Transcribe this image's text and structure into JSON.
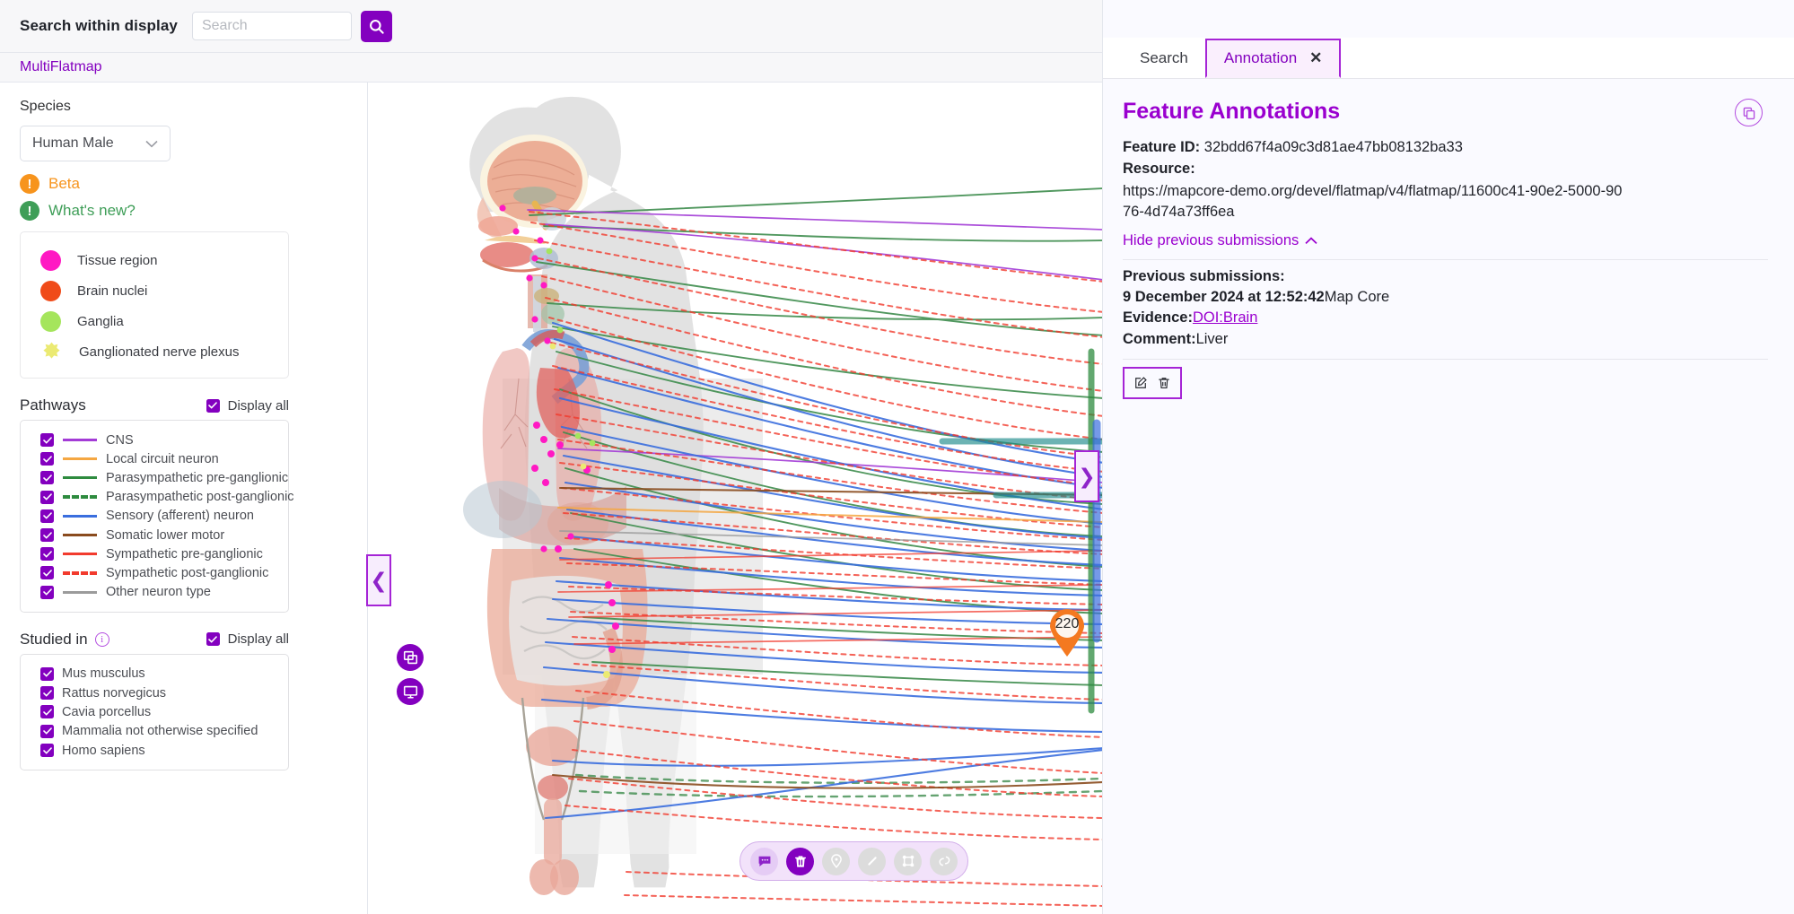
{
  "topbar": {
    "search_label": "Search within display",
    "search_value": "",
    "search_placeholder": "Search",
    "icons": [
      "window-icon",
      "help-icon",
      "fullscreen-icon",
      "link-icon"
    ]
  },
  "breadcrumb": {
    "label": "MultiFlatmap"
  },
  "sidebar": {
    "species_label": "Species",
    "species_value": "Human Male",
    "status": [
      {
        "label": "Beta",
        "color": "#f7941d",
        "glyph": "!"
      },
      {
        "label": "What's new?",
        "color": "#3f9e58",
        "glyph": "!"
      }
    ],
    "legend": [
      {
        "label": "Tissue region",
        "color": "#ff19c3",
        "shape": "circle"
      },
      {
        "label": "Brain nuclei",
        "color": "#f04b19",
        "shape": "circle"
      },
      {
        "label": "Ganglia",
        "color": "#a5e55c",
        "shape": "circle"
      },
      {
        "label": "Ganglionated nerve plexus",
        "color": "#ebea72",
        "shape": "star"
      }
    ],
    "pathways": {
      "title": "Pathways",
      "display_all_label": "Display all",
      "display_all_checked": true,
      "items": [
        {
          "label": "CNS",
          "color": "#a33bd6",
          "dashed": false,
          "checked": true
        },
        {
          "label": "Local circuit neuron",
          "color": "#f5a742",
          "dashed": false,
          "checked": true
        },
        {
          "label": "Parasympathetic pre-ganglionic",
          "color": "#2e8b3f",
          "dashed": false,
          "checked": true
        },
        {
          "label": "Parasympathetic post-ganglionic",
          "color": "#2e8b3f",
          "dashed": true,
          "checked": true
        },
        {
          "label": "Sensory (afferent) neuron",
          "color": "#3a6ede",
          "dashed": false,
          "checked": true
        },
        {
          "label": "Somatic lower motor",
          "color": "#8a4b1e",
          "dashed": false,
          "checked": true
        },
        {
          "label": "Sympathetic pre-ganglionic",
          "color": "#f23b2e",
          "dashed": false,
          "checked": true
        },
        {
          "label": "Sympathetic post-ganglionic",
          "color": "#f23b2e",
          "dashed": true,
          "checked": true
        },
        {
          "label": "Other neuron type",
          "color": "#9b9b9b",
          "dashed": false,
          "checked": true
        }
      ]
    },
    "studied_in": {
      "title": "Studied in",
      "info_glyph": "i",
      "display_all_label": "Display all",
      "display_all_checked": true,
      "items": [
        {
          "label": "Mus musculus",
          "checked": true
        },
        {
          "label": "Rattus norvegicus",
          "checked": true
        },
        {
          "label": "Cavia porcellus",
          "checked": true
        },
        {
          "label": "Mammalia not otherwise specified",
          "checked": true
        },
        {
          "label": "Homo sapiens",
          "checked": true
        }
      ]
    }
  },
  "map": {
    "marker_label": "220",
    "marker_color": "#f47920",
    "collapse_left_glyph": "❮",
    "collapse_right_glyph": "❯",
    "side_buttons": [
      "layers-icon",
      "display-icon"
    ],
    "toolbar": [
      {
        "name": "comment-tool",
        "state": "light"
      },
      {
        "name": "delete-tool",
        "state": "active"
      },
      {
        "name": "marker-tool",
        "state": "grey"
      },
      {
        "name": "line-tool",
        "state": "grey"
      },
      {
        "name": "polygon-tool",
        "state": "grey"
      },
      {
        "name": "connection-tool",
        "state": "grey"
      }
    ]
  },
  "panel": {
    "tabs": [
      {
        "label": "Search",
        "active": false,
        "closable": false
      },
      {
        "label": "Annotation",
        "active": true,
        "closable": true,
        "close_glyph": "✕"
      }
    ],
    "title": "Feature Annotations",
    "feature_id_label": "Feature ID:",
    "feature_id_value": "32bdd67f4a09c3d81ae47bb08132ba33",
    "resource_label": "Resource:",
    "resource_value": "https://mapcore-demo.org/devel/flatmap/v4/flatmap/11600c41-90e2-5000-9076-4d74a73ff6ea",
    "hide_link_label": "Hide previous submissions",
    "hide_link_glyph": "⌃",
    "previous_label": "Previous submissions:",
    "submission": {
      "date": "9 December 2024 at 12:52:42",
      "author": "Map Core",
      "evidence_label": "Evidence:",
      "evidence_value": "DOI:Brain",
      "comment_label": "Comment:",
      "comment_value": "Liver"
    },
    "actions": [
      {
        "name": "edit-annotation-button"
      },
      {
        "name": "delete-annotation-button"
      }
    ]
  },
  "colors": {
    "accent": "#8300bf",
    "accent_light": "#a524d6",
    "panel_bg": "#fafaff"
  }
}
